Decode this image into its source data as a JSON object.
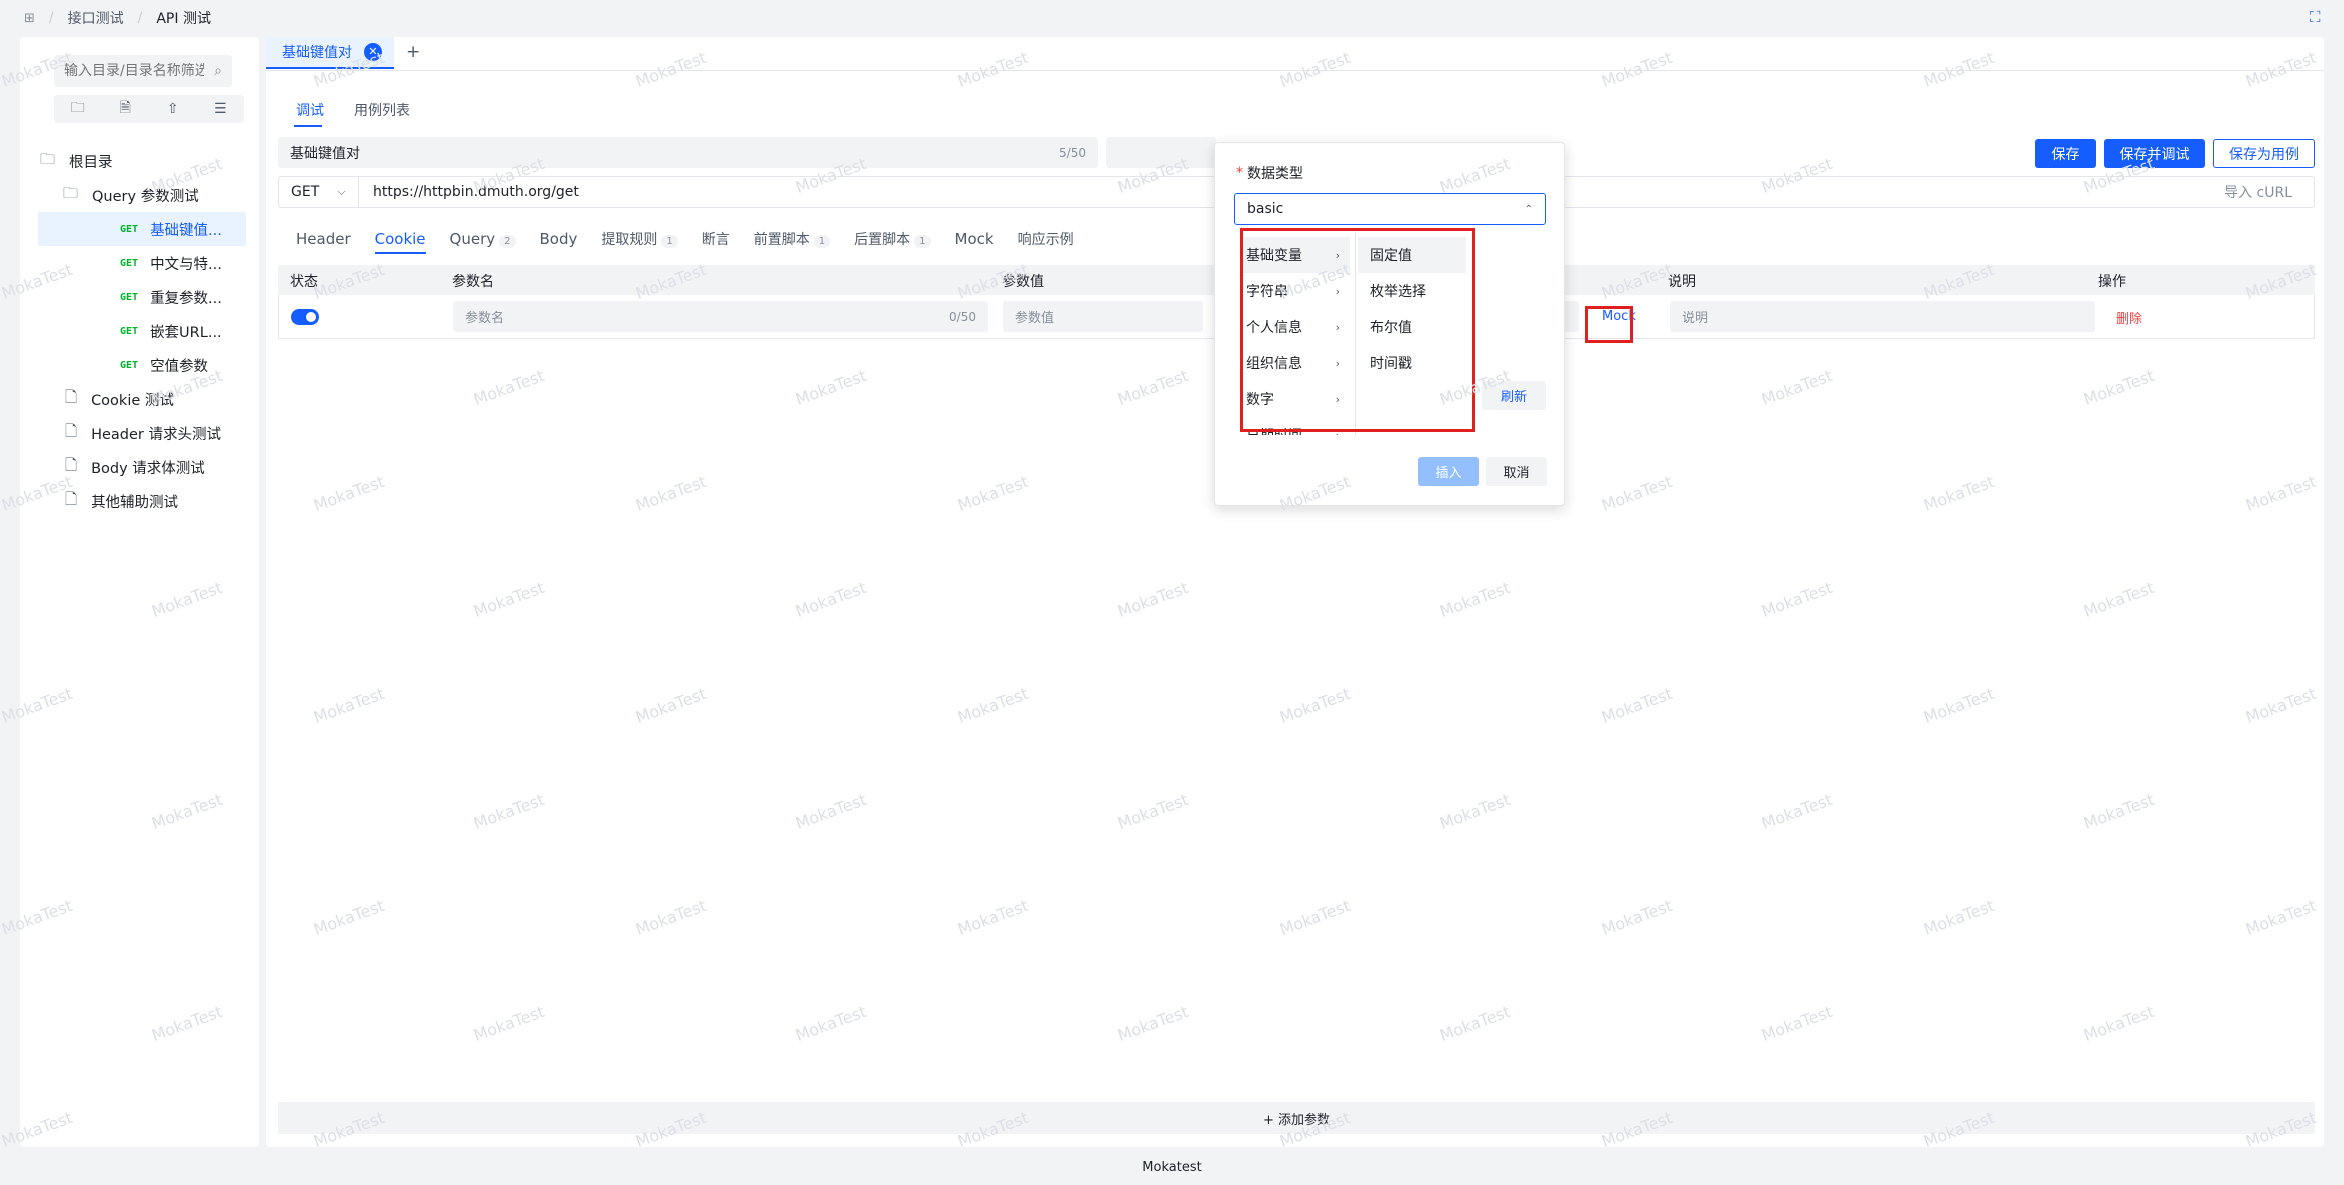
{
  "breadcrumb": {
    "home_icon": "grid-icon",
    "items": [
      "接口测试",
      "API 测试"
    ]
  },
  "sidebar": {
    "search_placeholder": "输入目录/目录名称筛选",
    "tree": [
      {
        "label": "根目录",
        "type": "folder"
      },
      {
        "label": "Query 参数测试",
        "type": "folder"
      },
      {
        "label": "基础键值...",
        "method": "GET",
        "selected": true
      },
      {
        "label": "中文与特...",
        "method": "GET"
      },
      {
        "label": "重复参数...",
        "method": "GET"
      },
      {
        "label": "嵌套URL...",
        "method": "GET"
      },
      {
        "label": "空值参数",
        "method": "GET"
      },
      {
        "label": "Cookie 测试",
        "type": "file"
      },
      {
        "label": "Header 请求头测试",
        "type": "file"
      },
      {
        "label": "Body 请求体测试",
        "type": "file"
      },
      {
        "label": "其他辅助测试",
        "type": "file"
      }
    ]
  },
  "tabs": {
    "active": "基础键值对",
    "add": "+"
  },
  "modes": {
    "debug": "调试",
    "cases": "用例列表"
  },
  "request": {
    "name": "基础键值对",
    "name_count": "5/50",
    "method": "GET",
    "url": "https://httpbin.dmuth.org/get",
    "import_curl": "导入 cURL",
    "save": "保存",
    "save_debug": "保存并调试",
    "save_case": "保存为用例"
  },
  "subtabs": [
    {
      "label": "Header"
    },
    {
      "label": "Cookie",
      "active": true
    },
    {
      "label": "Query",
      "badge": "2"
    },
    {
      "label": "Body"
    },
    {
      "label": "提取规则",
      "badge": "1"
    },
    {
      "label": "断言"
    },
    {
      "label": "前置脚本",
      "badge": "1"
    },
    {
      "label": "后置脚本",
      "badge": "1"
    },
    {
      "label": "Mock"
    },
    {
      "label": "响应示例"
    }
  ],
  "table": {
    "headers": {
      "status": "状态",
      "name": "参数名",
      "value": "参数值",
      "desc": "说明",
      "op": "操作"
    },
    "row": {
      "name_placeholder": "参数名",
      "name_count": "0/50",
      "value_placeholder": "参数值",
      "mock": "Mock",
      "desc_placeholder": "说明",
      "delete": "删除",
      "enabled": true
    }
  },
  "add_param": "+ 添加参数",
  "popup": {
    "label": "数据类型",
    "required": "*",
    "value": "basic",
    "categories": [
      "基础变量",
      "字符串",
      "个人信息",
      "组织信息",
      "数字",
      "日期时间"
    ],
    "options": [
      "固定值",
      "枚举选择",
      "布尔值",
      "时间戳"
    ],
    "refresh": "刷新",
    "insert": "插入",
    "cancel": "取消"
  },
  "watermark": "MokaTest",
  "footer": "Mokatest",
  "colors": {
    "primary": "#165dff",
    "success": "#00b42a",
    "danger": "#f53f3f",
    "highlight": "#e02020"
  }
}
